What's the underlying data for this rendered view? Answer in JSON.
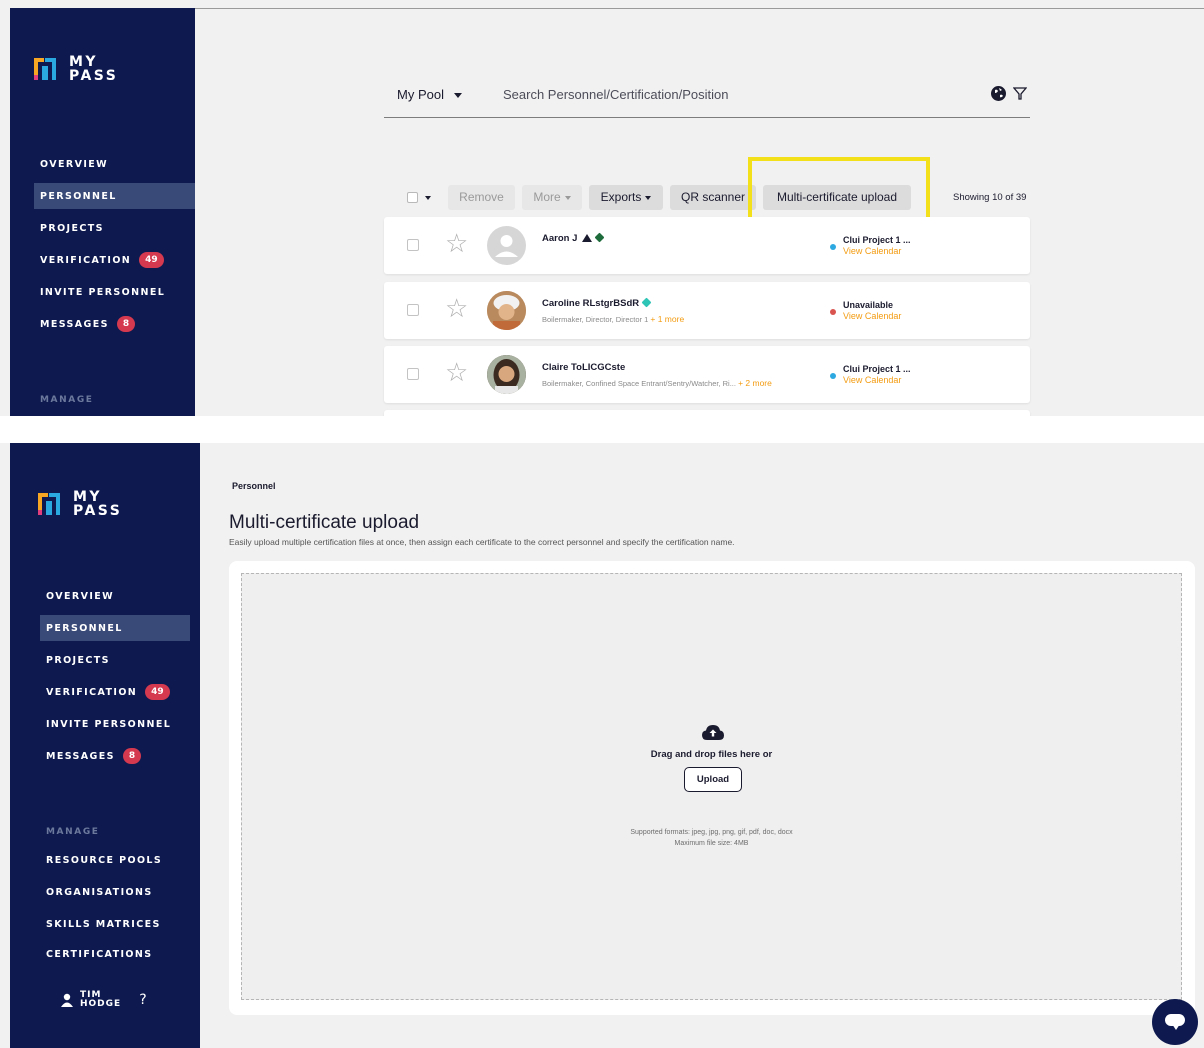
{
  "brand": {
    "line1": "MY",
    "line2": "PASS"
  },
  "colors": {
    "sidebar": "#0e1a4f",
    "active_item": "#3a4a78",
    "badge": "#d4394f",
    "accent_orange": "#f39c12",
    "highlight": "#f4df1b",
    "dot_blue": "#2ea8e0",
    "dot_red": "#d9534f"
  },
  "nav": {
    "items": [
      {
        "label": "OVERVIEW"
      },
      {
        "label": "PERSONNEL",
        "active": true
      },
      {
        "label": "PROJECTS"
      },
      {
        "label": "VERIFICATION",
        "badge": "49"
      },
      {
        "label": "INVITE PERSONNEL"
      },
      {
        "label": "MESSAGES",
        "badge": "8"
      }
    ],
    "manage_label": "MANAGE",
    "manage_items": [
      {
        "label": "RESOURCE POOLS"
      },
      {
        "label": "ORGANISATIONS"
      },
      {
        "label": "SKILLS MATRICES"
      },
      {
        "label": "CERTIFICATIONS"
      }
    ]
  },
  "personnel_list": {
    "pool_selector": "My Pool",
    "search_placeholder": "Search Personnel/Certification/Position",
    "icons": [
      "globe-icon",
      "filter-icon"
    ],
    "toolbar": {
      "remove": "Remove",
      "more": "More",
      "exports": "Exports",
      "qr_scanner": "QR scanner",
      "multi_upload": "Multi-certificate upload",
      "showing": "Showing 10 of 39"
    },
    "rows": [
      {
        "name": "Aaron J",
        "roles": "",
        "more": "",
        "status": "Clui Project 1 ...",
        "calendar": "View Calendar",
        "status_color": "#2ea8e0"
      },
      {
        "name": "Caroline RLstgrBSdR",
        "roles": "Boilermaker, Director, Director 1",
        "more": "+ 1 more",
        "status": "Unavailable",
        "calendar": "View Calendar",
        "status_color": "#d9534f"
      },
      {
        "name": "Claire ToLICGCste",
        "roles": "Boilermaker, Confined Space Entrant/Sentry/Watcher, Ri...",
        "more": "+ 2 more",
        "status": "Clui Project 1 ...",
        "calendar": "View Calendar",
        "status_color": "#2ea8e0"
      }
    ]
  },
  "upload_page": {
    "breadcrumb": "Personnel",
    "title": "Multi-certificate upload",
    "subtitle": "Easily upload multiple certification files at once, then assign each certificate to the correct personnel and specify the certification name.",
    "drop_text": "Drag and drop files here or",
    "upload_button": "Upload",
    "formats": "Supported formats: jpeg, jpg, png, gif, pdf, doc, docx",
    "max_size": "Maximum file size: 4MB"
  },
  "user": {
    "first": "TIM",
    "last": "HODGE",
    "help": "?"
  }
}
